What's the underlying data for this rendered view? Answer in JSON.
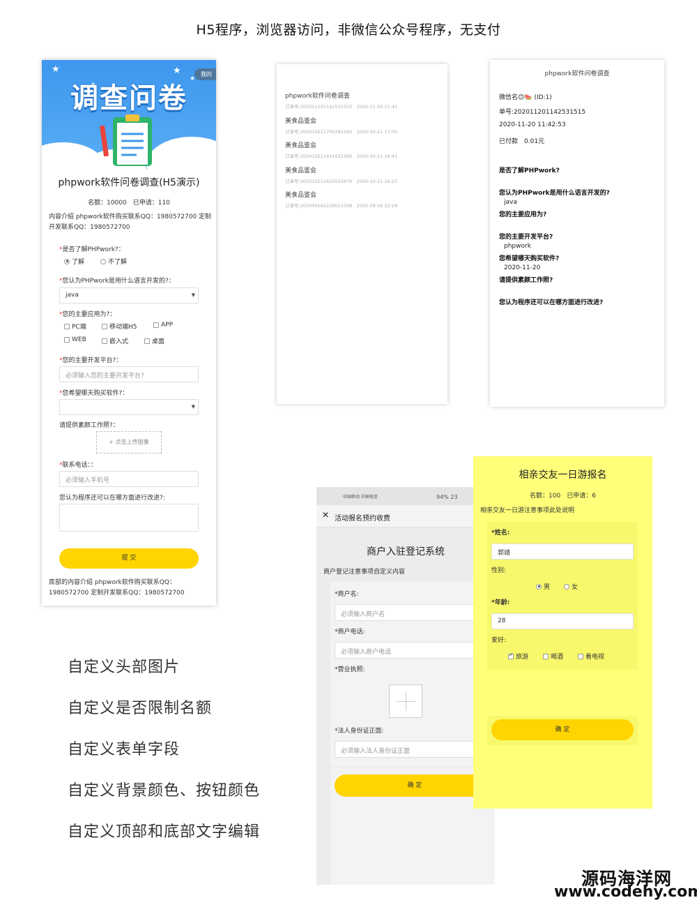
{
  "caption": "H5程序，浏览器访问，非微信公众号程序，无支付",
  "phone1": {
    "banner_title": "调查问卷",
    "mine_label": "我的",
    "title": "phpwork软件问卷调查(H5演示)",
    "quota": "名额：10000　已申请：110",
    "intro": "内容介绍 phpwork软件购买联系QQ：1980572700 定制开发联系QQ：1980572700",
    "q1": "是否了解PHPwork?：",
    "q1_opt1": "了解",
    "q1_opt2": "不了解",
    "q2": "您认为PHPwork是用什么语言开发的?：",
    "q2_value": "java",
    "q3": "您的主要应用为?：",
    "q3_opts": [
      "PC端",
      "移动端H5",
      "APP",
      "WEB",
      "嵌入式",
      "桌面"
    ],
    "q4": "您的主要开发平台?：",
    "q4_placeholder": "必须输入您的主要开发平台?",
    "q5": "您希望哪天购买软件?：",
    "q6": "请提供素颜工作照?：",
    "upload_label": "+ 点击上传图像",
    "q7": "联系电话：：",
    "q7_placeholder": "必须输入手机号",
    "q8": "您认为程序还可以在哪方面进行改进?:",
    "submit": "提 交",
    "footer": "底部的内容介绍 phpwork软件购买联系QQ：1980572700 定制开发联系QQ：1980572700"
  },
  "orders": {
    "items": [
      {
        "title": "phpwork软件问卷调查",
        "meta": "订单号:202011201142531515　2020-11-20 11:42"
      },
      {
        "title": "美食品鉴会",
        "meta": "订单号:202010211700292290　2020-10-21 17:00"
      },
      {
        "title": "美食品鉴会",
        "meta": "订单号:202010211641032396　2020-10-21 16:41"
      },
      {
        "title": "美食品鉴会",
        "meta": "订单号:202010211625052678　2020-10-21 16:25"
      },
      {
        "title": "美食品鉴会",
        "meta": "订单号:202009162229012338　2020-09-16 22:29"
      }
    ]
  },
  "detail": {
    "title": "phpwork软件问卷调查",
    "wechat": "微信名😊🍉 (ID:1)",
    "order_no": "单号:202011201142531515",
    "time": "2020-11-20 11:42:53",
    "paid": "已付款　0.01元",
    "q1": "是否了解PHPwork?",
    "q2": "您认为PHPwork是用什么语言开发的?",
    "a2": "java",
    "q3": "您的主要应用为?",
    "q4": "您的主要开发平台?",
    "a4": "phpwork",
    "q5": "您希望哪天购买软件?",
    "a5": "2020-11-20",
    "q6": "请提供素颜工作照?",
    "q7": "您认为程序还可以在哪方面进行改进?"
  },
  "features": [
    "自定义头部图片",
    "自定义是否限制名额",
    "自定义表单字段",
    "自定义背景颜色、按钮颜色",
    "自定义顶部和底部文字编辑"
  ],
  "phone4": {
    "status_left": "中国移动 中国电信",
    "status_right": "94%  23",
    "header_title": "活动报名预约收费",
    "title": "商户入驻登记系统",
    "note": "商户登记注意事项自定义内容",
    "f1_label": "*商户名:",
    "f1_placeholder": "必须输入商户名",
    "f2_label": "*商户电话:",
    "f2_placeholder": "必须输入商户电话",
    "f3_label": "*营业执照:",
    "f4_label": "*法人身份证正面:",
    "f4_placeholder": "必须输入法人身份证正面",
    "submit": "确 定"
  },
  "phone5": {
    "title": "相亲交友一日游报名",
    "quota": "名额：100　已申请：6",
    "note": "相亲交友一日游注意事项此处说明",
    "f1_label": "*姓名:",
    "f1_value": "郭靖",
    "f2_label": "性别:",
    "f2_opt1": "男",
    "f2_opt2": "女",
    "f3_label": "*年龄:",
    "f3_value": "28",
    "f4_label": "爱好:",
    "f4_opts": [
      "旅游",
      "喝酒",
      "看电视"
    ],
    "submit": "确 定"
  },
  "watermark": {
    "name": "源码海洋网",
    "url": "www.codehy.com"
  },
  "colors": {
    "banner_blue": "#3e97ee",
    "button_yellow": "#ffd400",
    "yellow_bg": "#ffff7a",
    "required_red": "#e33333"
  }
}
